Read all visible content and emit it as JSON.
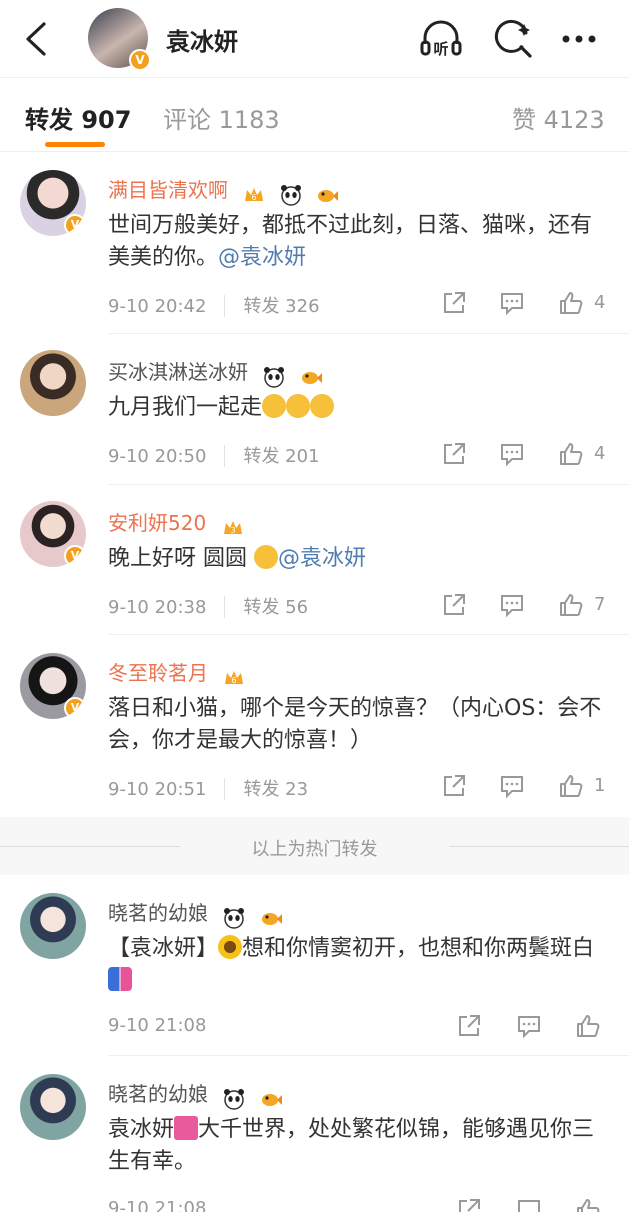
{
  "header": {
    "title": "袁冰妍",
    "icons": [
      "back-icon",
      "listen-icon",
      "search-icon",
      "more-icon"
    ],
    "listen_label": "听"
  },
  "tabs": [
    {
      "label": "转发 907",
      "active": true
    },
    {
      "label": "评论 1183",
      "active": false
    },
    {
      "label": "赞 4123",
      "active": false
    }
  ],
  "colors": {
    "accent": "#ff8200",
    "vip_name": "#eb7350",
    "mention": "#507daf",
    "muted": "#999999"
  },
  "items": [
    {
      "user": "满目皆清欢啊",
      "text_pre": "世间万般美好，都抵不过此刻，日落、猫咪，还有美美的你。",
      "mention": "@袁冰妍",
      "time": "9-10 20:42",
      "repost": "转发 326",
      "likes": "4"
    },
    {
      "user": "买冰淇淋送冰妍",
      "text_pre": "九月我们一起走",
      "time": "9-10 20:50",
      "repost": "转发 201",
      "likes": "4"
    },
    {
      "user": "安利妍520",
      "text_pre": "晚上好呀 圆圆",
      "mention": "@袁冰妍",
      "time": "9-10 20:38",
      "repost": "转发 56",
      "likes": "7"
    },
    {
      "user": "冬至聆茗月",
      "text_pre": "落日和小猫，哪个是今天的惊喜？（内心OS：会不会，你才是最大的惊喜！）",
      "time": "9-10 20:51",
      "repost": "转发 23",
      "likes": "1"
    },
    {
      "user": "晓茗的幼娘",
      "text_pre": "【袁冰妍】",
      "text_mid": "想和你情窦初开，也想和你两鬓斑白",
      "time": "9-10 21:08"
    },
    {
      "user": "晓茗的幼娘",
      "text_pre": "袁冰妍",
      "text_mid": "大千世界，处处繁花似锦，能够遇见你三生有幸。",
      "time": "9-10 21:08"
    }
  ],
  "hot_separator": "以上为热门转发"
}
